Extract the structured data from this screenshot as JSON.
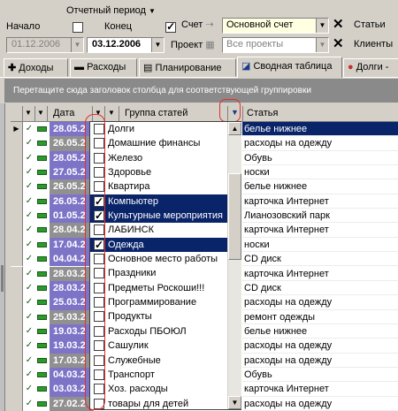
{
  "toolbar": {
    "period_label": "Отчетный период",
    "start_label": "Начало",
    "end_label": "Конец",
    "start_date": "01.12.2006",
    "end_date": "03.12.2006",
    "account_label": "Счет",
    "account_value": "Основной счет",
    "project_label": "Проект",
    "project_value": "Все проекты",
    "articles_label": "Статьи",
    "clients_label": "Клиенты"
  },
  "tabs": [
    {
      "label": "Доходы",
      "icon": "plus-icon"
    },
    {
      "label": "Расходы",
      "icon": "minus-icon"
    },
    {
      "label": "Планирование",
      "icon": "calendar-icon"
    },
    {
      "label": "Сводная таблица",
      "icon": "pivot-table-icon",
      "active": true
    },
    {
      "label": "Долги - ",
      "icon": "debt-icon"
    }
  ],
  "group_hint": "Перетащите сюда заголовок столбца для соответствующей группировки",
  "columns": {
    "date": "Дата",
    "group": "Группа статей",
    "article": "Статья"
  },
  "rows": [
    {
      "date": "28.05.2",
      "article": "белье нижнее",
      "selected": true
    },
    {
      "date": "26.05.2",
      "article": "расходы на одежду"
    },
    {
      "date": "28.05.2",
      "article": "Обувь"
    },
    {
      "date": "27.05.2",
      "article": "носки"
    },
    {
      "date": "26.05.2",
      "article": "белье нижнее"
    },
    {
      "date": "26.05.2",
      "article": "карточка Интернет"
    },
    {
      "date": "01.05.2",
      "article": "Лианозовский парк"
    },
    {
      "date": "28.04.2",
      "article": "карточка Интернет"
    },
    {
      "date": "17.04.2",
      "article": "носки"
    },
    {
      "date": "04.04.2",
      "article": "CD диск"
    },
    {
      "date": "28.03.2",
      "article": "карточка Интернет"
    },
    {
      "date": "28.03.2",
      "article": "CD диск"
    },
    {
      "date": "25.03.2",
      "article": "расходы на одежду"
    },
    {
      "date": "25.03.2",
      "article": "ремонт одежды"
    },
    {
      "date": "19.03.2",
      "article": "белье нижнее"
    },
    {
      "date": "19.03.2",
      "article": "расходы на одежду"
    },
    {
      "date": "17.03.2",
      "article": "расходы на одежду"
    },
    {
      "date": "04.03.2",
      "article": "Обувь"
    },
    {
      "date": "03.03.2",
      "article": "карточка Интернет"
    },
    {
      "date": "27.02.2",
      "article": "расходы на одежду"
    }
  ],
  "dropdown_items": [
    {
      "label": "Долги",
      "checked": false,
      "selected": false
    },
    {
      "label": "Домашние финансы",
      "checked": false,
      "selected": false
    },
    {
      "label": "Железо",
      "checked": false,
      "selected": false
    },
    {
      "label": "Здоровье",
      "checked": false,
      "selected": false
    },
    {
      "label": "Квартира",
      "checked": false,
      "selected": false
    },
    {
      "label": "Компьютер",
      "checked": true,
      "selected": true
    },
    {
      "label": "Культурные мероприятия",
      "checked": true,
      "selected": true
    },
    {
      "label": "ЛАБИНСК",
      "checked": false,
      "selected": false
    },
    {
      "label": "Одежда",
      "checked": true,
      "selected": true
    },
    {
      "label": "Основное место работы",
      "checked": false,
      "selected": false
    },
    {
      "label": "Праздники",
      "checked": false,
      "selected": false
    },
    {
      "label": "Предметы Роскоши!!!",
      "checked": false,
      "selected": false
    },
    {
      "label": "Программирование",
      "checked": false,
      "selected": false
    },
    {
      "label": "Продукты",
      "checked": false,
      "selected": false
    },
    {
      "label": "Расходы ПБОЮЛ",
      "checked": false,
      "selected": false
    },
    {
      "label": "Сашулик",
      "checked": false,
      "selected": false
    },
    {
      "label": "Служебные",
      "checked": false,
      "selected": false
    },
    {
      "label": "Транспорт",
      "checked": false,
      "selected": false
    },
    {
      "label": "Хоз. расходы",
      "checked": false,
      "selected": false
    },
    {
      "label": "товары для детей",
      "checked": false,
      "selected": false
    }
  ],
  "colors": {
    "highlight": "#0a246a",
    "date_bg": "#7d74c8",
    "date_bg_alt": "#909090",
    "focus_ring": "#e03030"
  }
}
